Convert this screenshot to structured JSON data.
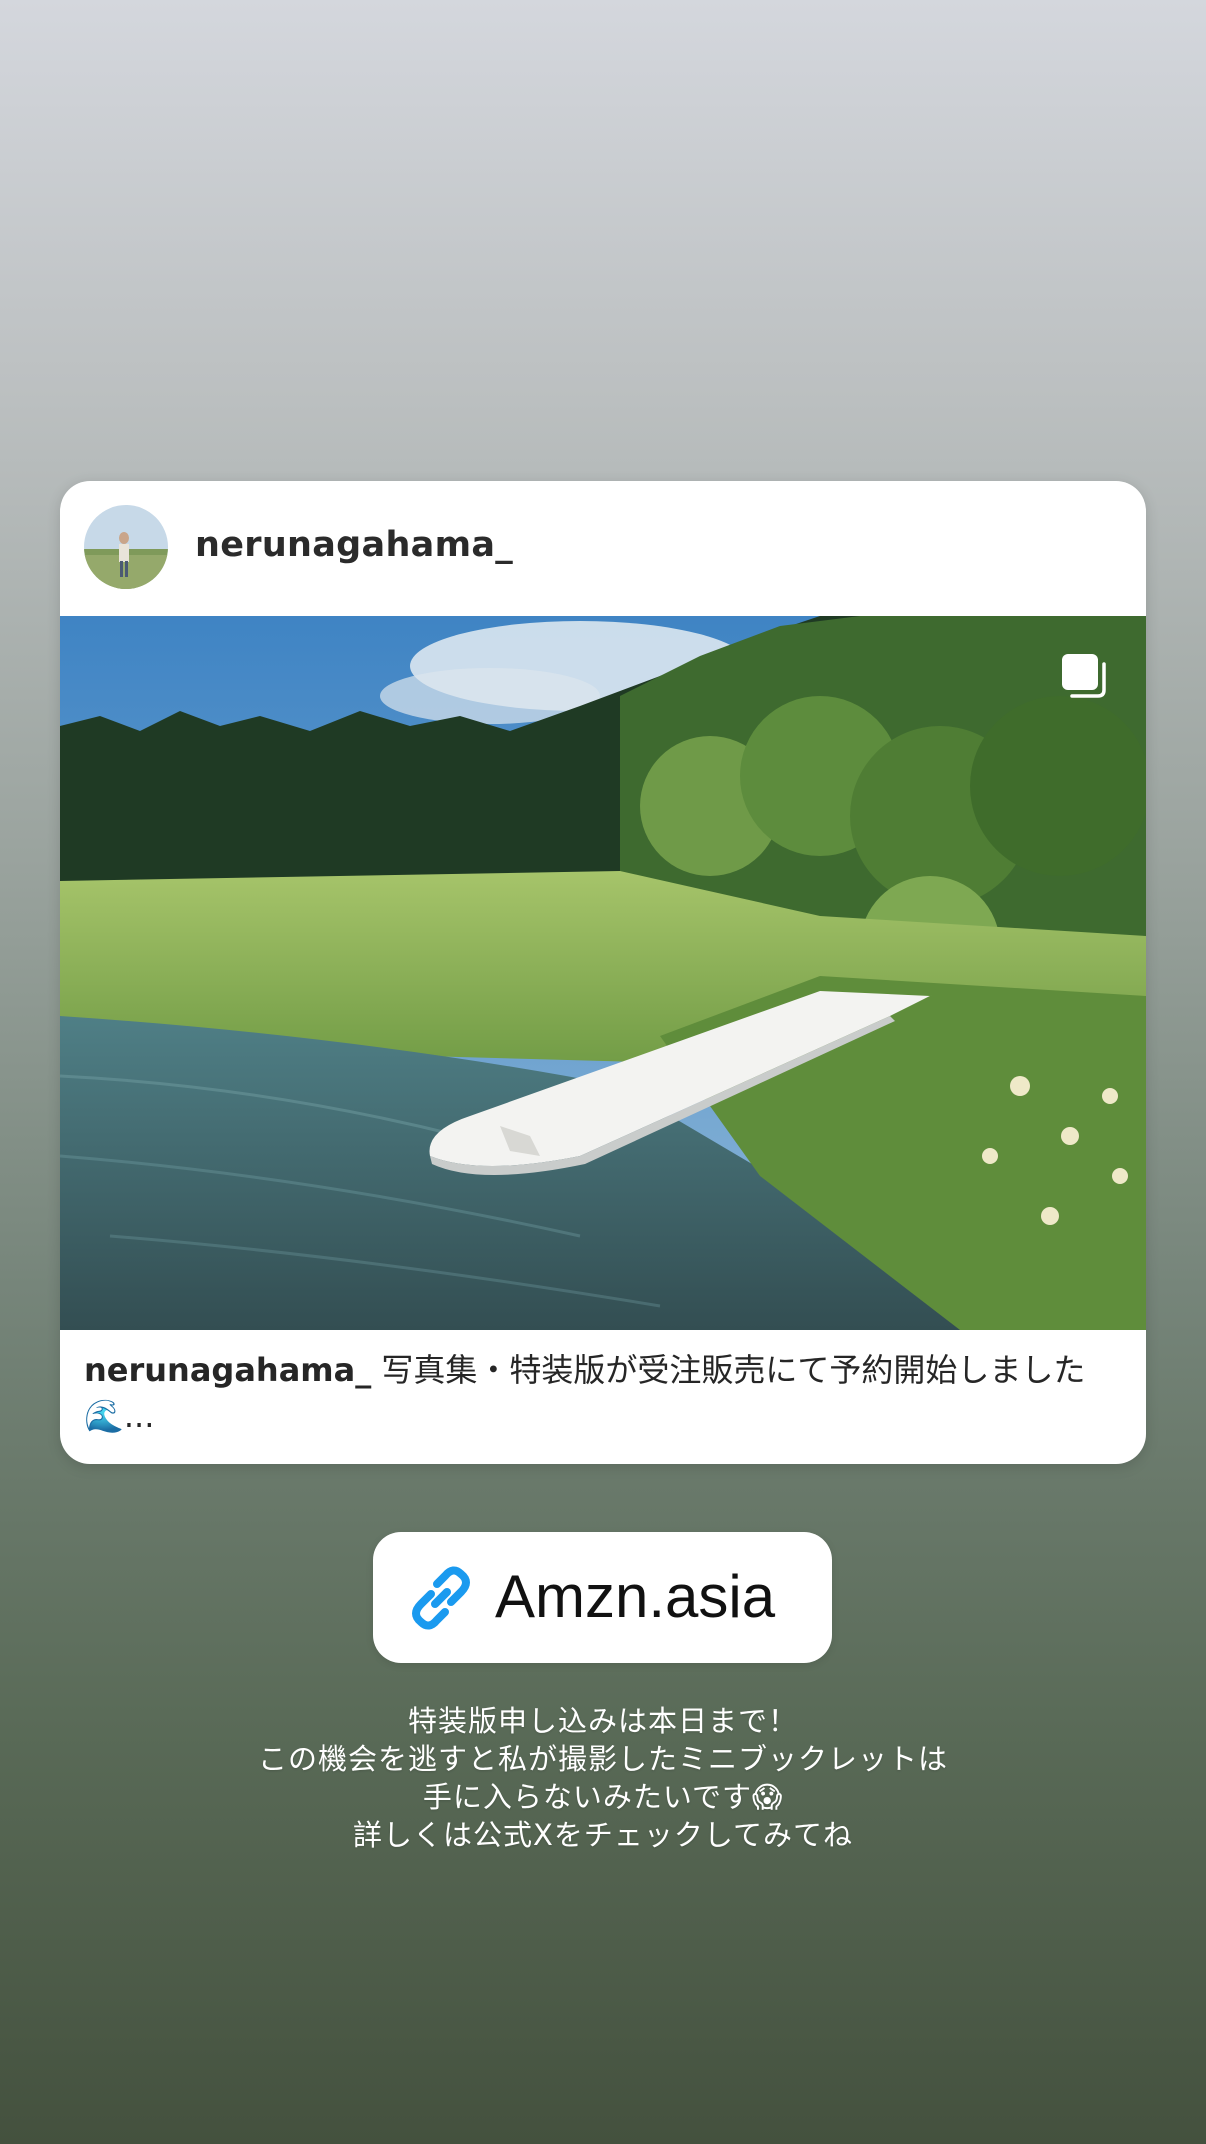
{
  "post_card": {
    "username": "nerunagahama_",
    "avatar_icon": "profile-photo-avatar",
    "multi_photo_icon": "carousel-icon",
    "caption_user": "nerunagahama_",
    "caption_text": " 写真集・特装版が受注販売にて予約開始しました🌊..."
  },
  "link_sticker": {
    "icon": "link-icon",
    "label": "Amzn.asia",
    "accent_color": "#1a9aef"
  },
  "story_text": {
    "lines": [
      "特装版申し込みは本日まで！",
      "この機会を逃すと私が撮影したミニブックレットは",
      "手に入らないみたいです😱",
      "詳しくは公式Xをチェックしてみてね"
    ]
  }
}
